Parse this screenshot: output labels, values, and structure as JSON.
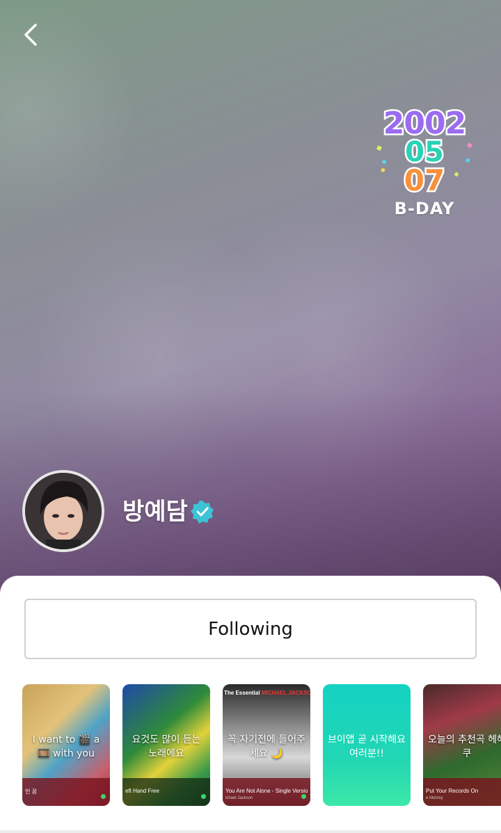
{
  "profile": {
    "name": "방예담",
    "verified": true
  },
  "birthday_sticker": {
    "year": "2002",
    "month": "05",
    "day": "07",
    "label": "B-DAY"
  },
  "actions": {
    "follow_label": "Following"
  },
  "cards": [
    {
      "text": "I want to 🎬 a 🎞️ with you",
      "footer_title": "인 꿈",
      "footer_sub": ""
    },
    {
      "text": "요것도 많이 듣는 노래에요",
      "footer_title": "eft Hand Free",
      "footer_sub": ""
    },
    {
      "text": "꼭 자기전에 들어주세요 🌙",
      "footer_title": "You Are Not Alone - Single Versio",
      "footer_sub": "ichael Jackson",
      "jacket_title": "The Essential",
      "jacket_artist": "MICHAEL JACKSON"
    },
    {
      "text": "브이앱 곧 시작해요 여러분!!",
      "footer_title": "",
      "footer_sub": ""
    },
    {
      "text": "오늘의 추천곡 헤헤쿠",
      "footer_title": "Put Your Records On",
      "footer_sub": "e Mornsy"
    }
  ],
  "icons": {
    "back": "back-chevron-icon",
    "verified": "verified-badge-icon",
    "avatar": "profile-avatar"
  },
  "colors": {
    "verified": "#3cc4d6",
    "sticker_year": "#9b6cf0",
    "sticker_month": "#27d3b5",
    "sticker_day": "#f7923c",
    "card_mint": "#21d6b4"
  }
}
